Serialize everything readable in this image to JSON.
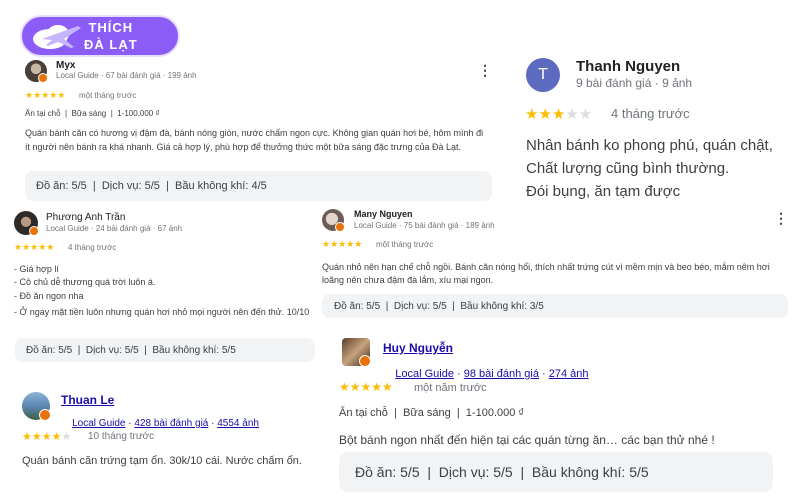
{
  "brand": {
    "line1": "THÍCH",
    "line2": "ĐÀ LẠT",
    "color": "#8b5cf6"
  },
  "reviews": [
    {
      "name": "Myx",
      "meta": "Local Guide · 67 bài đánh giá · 199 ảnh",
      "rating": 5,
      "time": "một tháng trước",
      "tags": "Ăn tại chỗ  |  Bữa sáng  |  1-100.000 ₫",
      "text": "Quán bánh căn có hương vị đậm đà, bánh nóng giòn, nước chấm ngon cực. Không gian quán hơi bé, hôm mình đi ít người nên bánh ra khá nhanh. Giá cả hợp lý, phù hợp để thưởng thức một bữa sáng đặc trưng của Đà Lạt.",
      "scores": "Đồ ăn: 5/5  |  Dịch vụ: 5/5  |  Bầu không khí: 4/5",
      "menu_icon": "more-vert-icon"
    },
    {
      "name": "Thanh Nguyen",
      "initial": "T",
      "avatar_color": "#5c6bc0",
      "meta": "9 bài đánh giá · 9 ảnh",
      "rating": 3,
      "time": "4 tháng trước",
      "text_lines": [
        "Nhân bánh ko phong phú, quán chật,",
        "Chất lượng cũng bình thường.",
        "Đói bụng, ăn tạm được"
      ]
    },
    {
      "name": "Phương Anh Trần",
      "meta": "Local Guide · 24 bài đánh giá · 67 ảnh",
      "rating": 5,
      "time": "4 tháng trước",
      "text_lines": [
        "- Giá hợp lí",
        "- Cô chủ dễ thương quá trời luôn á.",
        "- Đồ ăn ngon nha",
        "- Ở ngay mặt tiền luôn nhưng quán hơi nhỏ mọi người nên đến thử. 10/10"
      ],
      "scores": "Đồ ăn: 5/5  |  Dịch vụ: 5/5  |  Bầu không khí: 5/5"
    },
    {
      "name": "Many Nguyen",
      "meta": "Local Guide · 75 bài đánh giá · 189 ảnh",
      "rating": 5,
      "time": "một tháng trước",
      "text": "Quán nhỏ nên hạn chế chỗ ngồi. Bánh căn nóng hổi, thích nhất trứng cút vì mềm mịn và beo béo, mắm nêm hơi loãng nên chưa đậm đà lắm, xíu mại ngon.",
      "scores": "Đồ ăn: 5/5  |  Dịch vụ: 5/5  |  Bầu không khí: 3/5",
      "menu_icon": "more-vert-icon"
    },
    {
      "name": "Huy Nguyễn",
      "meta_prefix": "Local Guide",
      "meta_reviews": "98 bài đánh giá",
      "meta_photos": "274 ảnh",
      "rating": 5,
      "time": "một năm trước",
      "tags": "Ăn tại chỗ  |  Bữa sáng  |  1-100.000 ₫",
      "text": "Bột bánh ngon nhất đến hiện tại các quán từng ăn… các bạn thử nhé !",
      "scores": "Đồ ăn: 5/5  |  Dịch vụ: 5/5  |  Bầu không khí: 5/5"
    },
    {
      "name": "Thuan Le",
      "meta_prefix": "Local Guide",
      "meta_reviews": "428 bài đánh giá",
      "meta_photos": "4554 ảnh",
      "rating": 4,
      "time": "10 tháng trước",
      "text": "Quán bánh căn trứng tạm ổn. 30k/10 cái. Nước chấm ổn."
    }
  ],
  "colors": {
    "star": "#fbbc04",
    "star_off": "#dadce0",
    "link": "#1a0dab",
    "badge": "#e8710a"
  }
}
